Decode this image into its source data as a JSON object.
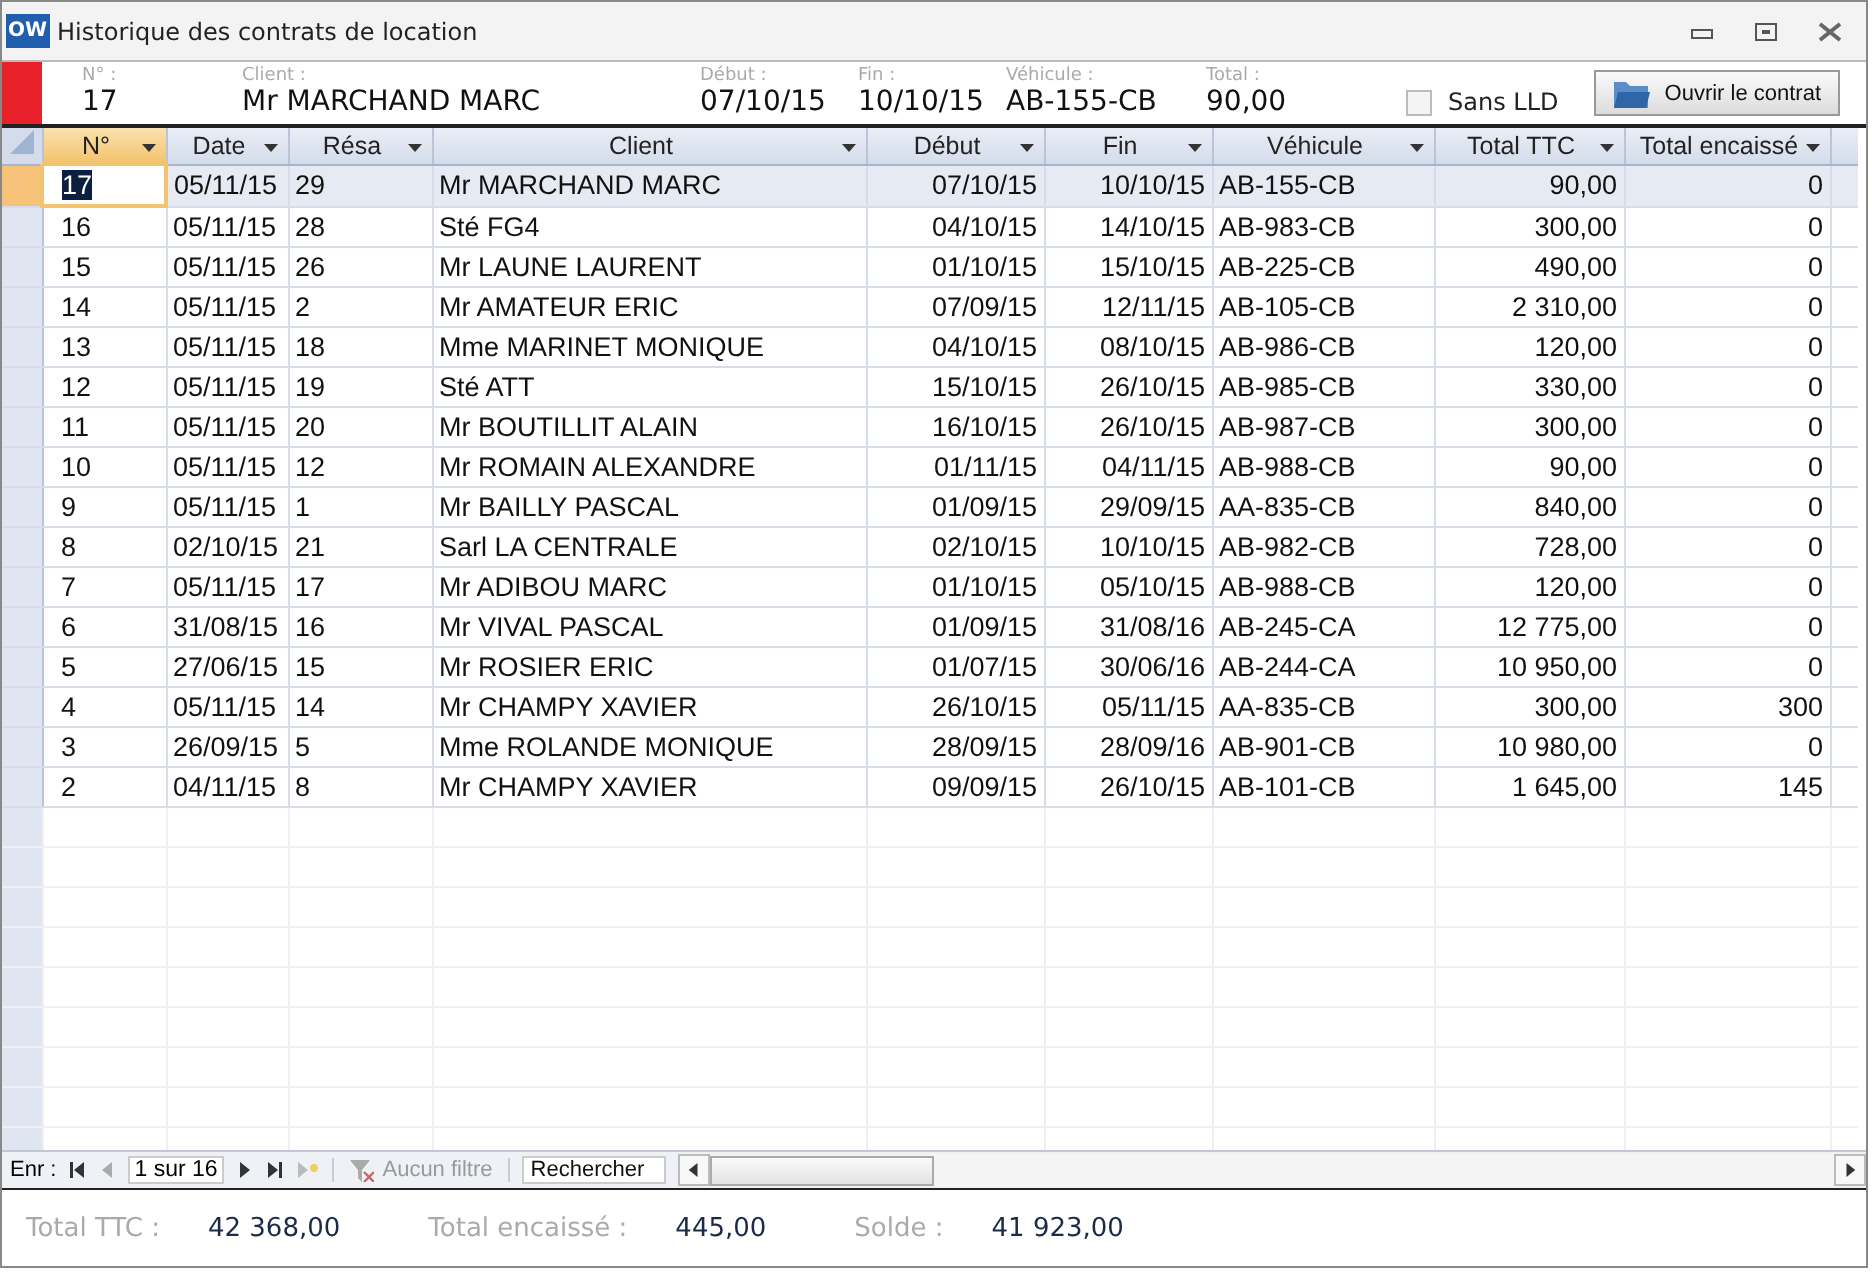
{
  "window": {
    "title": "Historique des contrats de location",
    "app_badge": "OW"
  },
  "summary": [
    {
      "label": "N° :",
      "value": "17"
    },
    {
      "label": "Client :",
      "value": "Mr MARCHAND MARC"
    },
    {
      "label": "Début :",
      "value": "07/10/15"
    },
    {
      "label": "Fin :",
      "value": "10/10/15"
    },
    {
      "label": "Véhicule :",
      "value": "AB-155-CB"
    },
    {
      "label": "Total :",
      "value": "90,00"
    }
  ],
  "sans_lld": {
    "label": "Sans LLD",
    "checked": false
  },
  "open_button": "Ouvrir le contrat",
  "table": {
    "columns": [
      {
        "label": "N°",
        "selected": true
      },
      {
        "label": "Date",
        "selected": false
      },
      {
        "label": "Résa",
        "selected": false
      },
      {
        "label": "Client",
        "selected": false
      },
      {
        "label": "Début",
        "selected": false
      },
      {
        "label": "Fin",
        "selected": false
      },
      {
        "label": "Véhicule",
        "selected": false
      },
      {
        "label": "Total TTC",
        "selected": false
      },
      {
        "label": "Total encaissé",
        "selected": false
      }
    ],
    "rows": [
      {
        "cells": [
          "17",
          "05/11/15",
          "29",
          "Mr MARCHAND MARC",
          "07/10/15",
          "10/10/15",
          "AB-155-CB",
          "90,00",
          "0"
        ],
        "selected": true
      },
      {
        "cells": [
          "16",
          "05/11/15",
          "28",
          "Sté FG4",
          "04/10/15",
          "14/10/15",
          "AB-983-CB",
          "300,00",
          "0"
        ],
        "selected": false
      },
      {
        "cells": [
          "15",
          "05/11/15",
          "26",
          "Mr LAUNE LAURENT",
          "01/10/15",
          "15/10/15",
          "AB-225-CB",
          "490,00",
          "0"
        ],
        "selected": false
      },
      {
        "cells": [
          "14",
          "05/11/15",
          "2",
          "Mr AMATEUR ERIC",
          "07/09/15",
          "12/11/15",
          "AB-105-CB",
          "2 310,00",
          "0"
        ],
        "selected": false
      },
      {
        "cells": [
          "13",
          "05/11/15",
          "18",
          "Mme MARINET MONIQUE",
          "04/10/15",
          "08/10/15",
          "AB-986-CB",
          "120,00",
          "0"
        ],
        "selected": false
      },
      {
        "cells": [
          "12",
          "05/11/15",
          "19",
          "Sté ATT",
          "15/10/15",
          "26/10/15",
          "AB-985-CB",
          "330,00",
          "0"
        ],
        "selected": false
      },
      {
        "cells": [
          "11",
          "05/11/15",
          "20",
          "Mr BOUTILLIT ALAIN",
          "16/10/15",
          "26/10/15",
          "AB-987-CB",
          "300,00",
          "0"
        ],
        "selected": false
      },
      {
        "cells": [
          "10",
          "05/11/15",
          "12",
          "Mr ROMAIN ALEXANDRE",
          "01/11/15",
          "04/11/15",
          "AB-988-CB",
          "90,00",
          "0"
        ],
        "selected": false
      },
      {
        "cells": [
          "9",
          "05/11/15",
          "1",
          "Mr BAILLY PASCAL",
          "01/09/15",
          "29/09/15",
          "AA-835-CB",
          "840,00",
          "0"
        ],
        "selected": false
      },
      {
        "cells": [
          "8",
          "02/10/15",
          "21",
          "Sarl LA CENTRALE",
          "02/10/15",
          "10/10/15",
          "AB-982-CB",
          "728,00",
          "0"
        ],
        "selected": false
      },
      {
        "cells": [
          "7",
          "05/11/15",
          "17",
          "Mr ADIBOU MARC",
          "01/10/15",
          "05/10/15",
          "AB-988-CB",
          "120,00",
          "0"
        ],
        "selected": false
      },
      {
        "cells": [
          "6",
          "31/08/15",
          "16",
          "Mr VIVAL PASCAL",
          "01/09/15",
          "31/08/16",
          "AB-245-CA",
          "12 775,00",
          "0"
        ],
        "selected": false
      },
      {
        "cells": [
          "5",
          "27/06/15",
          "15",
          "Mr ROSIER ERIC",
          "01/07/15",
          "30/06/16",
          "AB-244-CA",
          "10 950,00",
          "0"
        ],
        "selected": false
      },
      {
        "cells": [
          "4",
          "05/11/15",
          "14",
          "Mr CHAMPY XAVIER",
          "26/10/15",
          "05/11/15",
          "AA-835-CB",
          "300,00",
          "300"
        ],
        "selected": false
      },
      {
        "cells": [
          "3",
          "26/09/15",
          "5",
          "Mme ROLANDE MONIQUE",
          "28/09/15",
          "28/09/16",
          "AB-901-CB",
          "10 980,00",
          "0"
        ],
        "selected": false
      },
      {
        "cells": [
          "2",
          "04/11/15",
          "8",
          "Mr CHAMPY XAVIER",
          "09/09/15",
          "26/10/15",
          "AB-101-CB",
          "1 645,00",
          "145"
        ],
        "selected": false
      }
    ]
  },
  "navigator": {
    "label": "Enr :",
    "position": "1 sur 16",
    "filter": "Aucun filtre",
    "search_placeholder": "Rechercher"
  },
  "totals": [
    {
      "label": "Total TTC :",
      "value": "42 368,00"
    },
    {
      "label": "Total encaissé :",
      "value": "445,00"
    },
    {
      "label": "Solde :",
      "value": "41 923,00"
    }
  ]
}
